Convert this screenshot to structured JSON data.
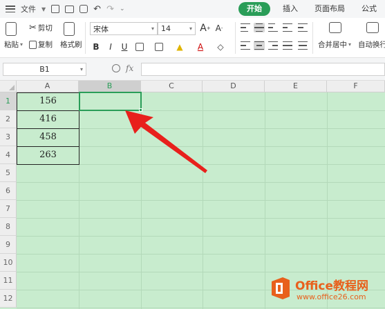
{
  "menubar": {
    "file_label": "文件"
  },
  "tabs": [
    {
      "label": "开始",
      "active": true
    },
    {
      "label": "插入"
    },
    {
      "label": "页面布局"
    },
    {
      "label": "公式"
    }
  ],
  "ribbon": {
    "paste_label": "粘贴",
    "cut_label": "剪切",
    "copy_label": "复制",
    "format_painter_label": "格式刷",
    "font_name": "宋体",
    "font_size": "14",
    "merge_label": "合并居中",
    "wrap_label": "自动换行"
  },
  "formula_bar": {
    "name_box": "B1",
    "fx_label": "fx",
    "value": ""
  },
  "grid": {
    "columns": [
      "A",
      "B",
      "C",
      "D",
      "E",
      "F"
    ],
    "selected_column": "B",
    "rows": [
      "1",
      "2",
      "3",
      "4",
      "5",
      "6",
      "7",
      "8",
      "9",
      "10",
      "11",
      "12"
    ],
    "selected_row": "1",
    "active_cell": "B1",
    "cells": {
      "A1": "156",
      "A2": "416",
      "A3": "458",
      "A4": "263"
    }
  },
  "watermark": {
    "title": "Office教程网",
    "url": "www.office26.com"
  },
  "colors": {
    "accent": "#2a9d58",
    "sheet_bg": "#c8ecce",
    "arrow": "#e8201c",
    "watermark": "#e8601c"
  }
}
